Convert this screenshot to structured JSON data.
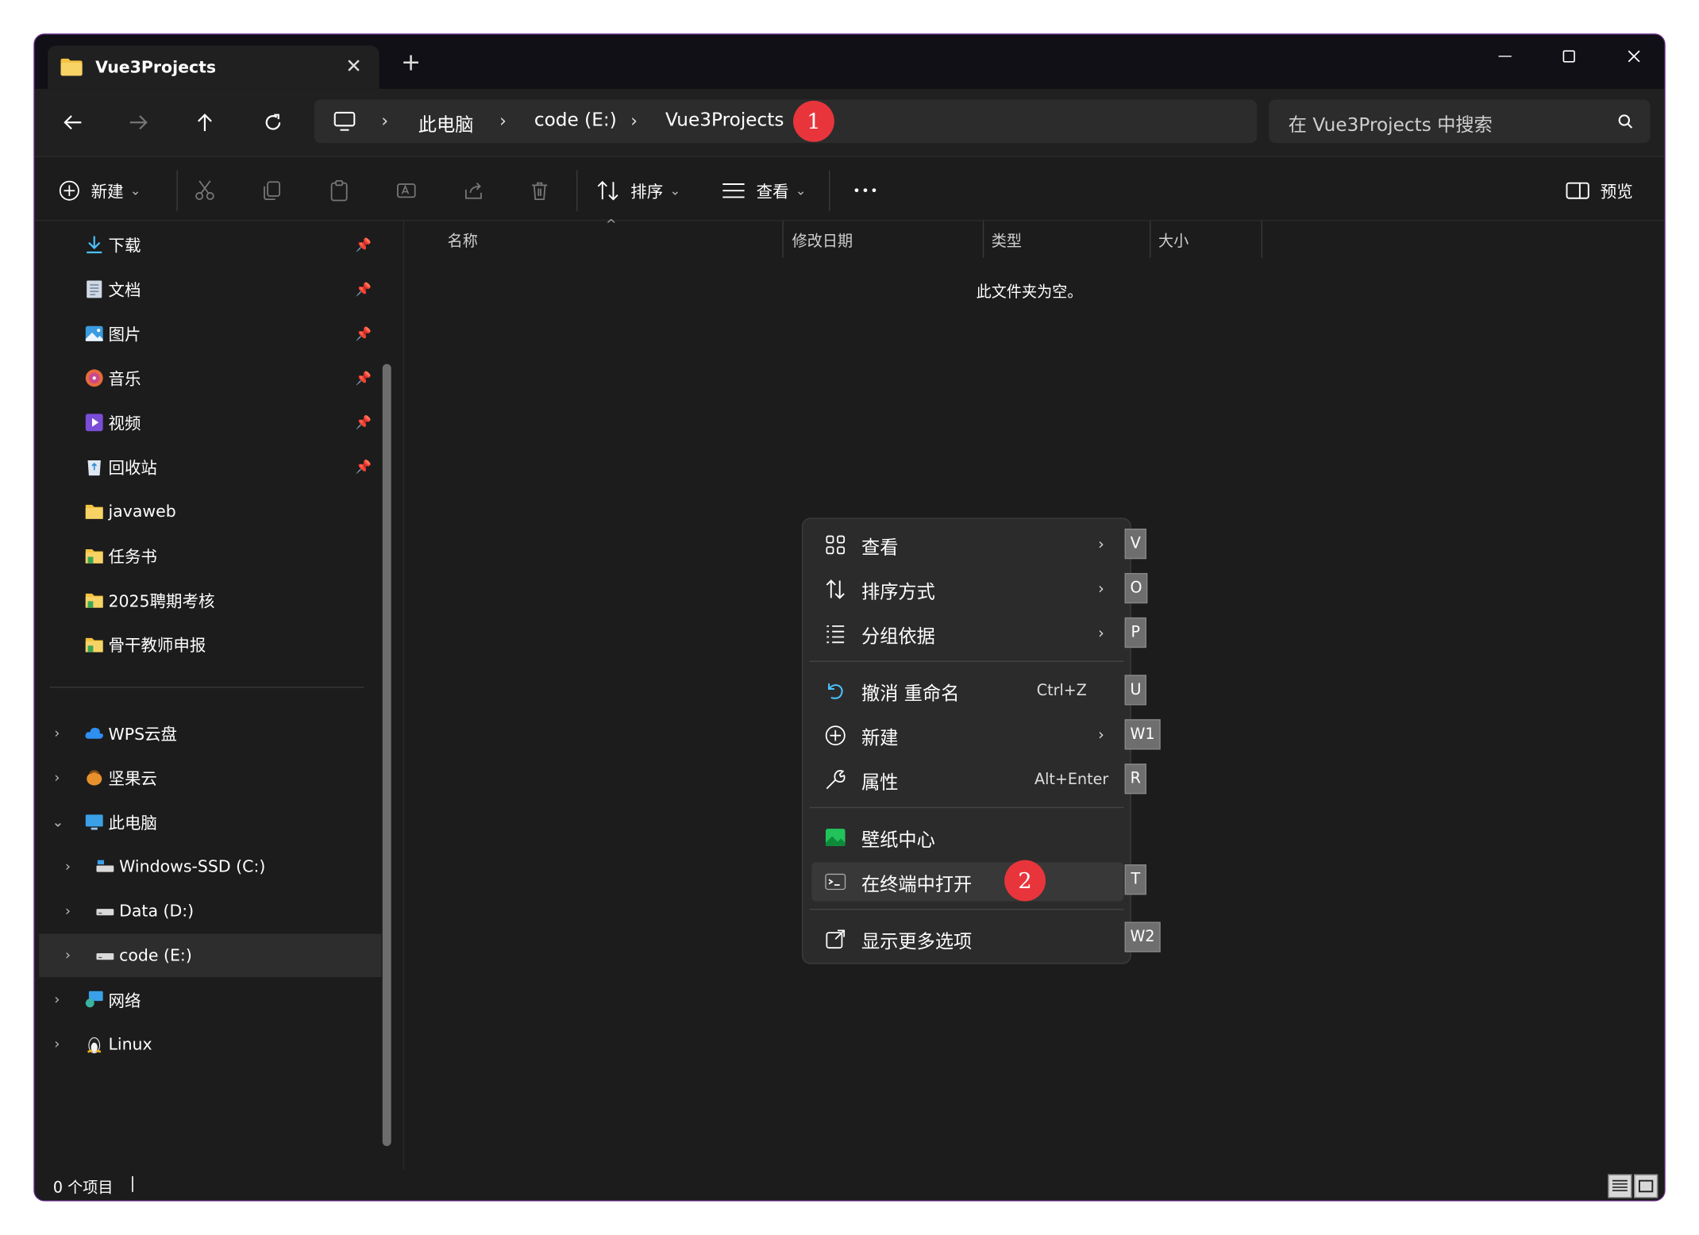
{
  "window": {
    "tab_title": "Vue3Projects",
    "tab_close": "✕",
    "new_tab": "+"
  },
  "address": {
    "crumbs": [
      "此电脑",
      "code (E:)",
      "Vue3Projects"
    ],
    "separator": "›"
  },
  "search": {
    "placeholder": "在 Vue3Projects 中搜索"
  },
  "toolbar": {
    "new_label": "新建",
    "sort_label": "排序",
    "view_label": "查看",
    "more_label": "•••",
    "preview_label": "预览",
    "dropdown": "⌄"
  },
  "sidebar": {
    "quick_access": [
      {
        "label": "下载",
        "icon": "download-icon"
      },
      {
        "label": "文档",
        "icon": "document-icon"
      },
      {
        "label": "图片",
        "icon": "pictures-icon"
      },
      {
        "label": "音乐",
        "icon": "music-icon"
      },
      {
        "label": "视频",
        "icon": "video-icon"
      },
      {
        "label": "回收站",
        "icon": "recycle-bin-icon"
      },
      {
        "label": "javaweb",
        "icon": "folder-icon"
      },
      {
        "label": "任务书",
        "icon": "folder-icon"
      },
      {
        "label": "2025聘期考核",
        "icon": "folder-icon"
      },
      {
        "label": "骨干教师申报",
        "icon": "folder-icon"
      }
    ],
    "pin": "📌",
    "tree": [
      {
        "label": "WPS云盘",
        "icon": "cloud-icon",
        "expanded": false
      },
      {
        "label": "坚果云",
        "icon": "nutstore-icon",
        "expanded": false
      },
      {
        "label": "此电脑",
        "icon": "computer-icon",
        "expanded": true
      },
      {
        "label": "Windows-SSD (C:)",
        "icon": "drive-icon",
        "expanded": false
      },
      {
        "label": "Data (D:)",
        "icon": "drive-icon",
        "expanded": false
      },
      {
        "label": "code (E:)",
        "icon": "drive-icon",
        "expanded": false,
        "selected": true
      },
      {
        "label": "网络",
        "icon": "network-icon",
        "expanded": false
      },
      {
        "label": "Linux",
        "icon": "linux-icon",
        "expanded": false
      }
    ],
    "chev_right": "›",
    "chev_down": "⌄"
  },
  "columns": [
    "名称",
    "修改日期",
    "类型",
    "大小"
  ],
  "sort_caret": "^",
  "empty_message": "此文件夹为空。",
  "status": {
    "items": "0 个项目",
    "bar": "|"
  },
  "context_menu": {
    "items": [
      {
        "label": "查看",
        "key": "V",
        "arrow": "›"
      },
      {
        "label": "排序方式",
        "key": "O",
        "arrow": "›"
      },
      {
        "label": "分组依据",
        "key": "P",
        "arrow": "›"
      },
      {
        "label": "撤消 重命名",
        "key": "U",
        "shortcut": "Ctrl+Z"
      },
      {
        "label": "新建",
        "key": "W1",
        "arrow": "›"
      },
      {
        "label": "属性",
        "key": "R",
        "shortcut": "Alt+Enter"
      },
      {
        "label": "壁纸中心",
        "key": ""
      },
      {
        "label": "在终端中打开",
        "key": "T"
      },
      {
        "label": "显示更多选项",
        "key": "W2"
      }
    ]
  },
  "annotations": [
    "1",
    "2"
  ],
  "colors": {
    "accent": "#4cc2ff",
    "badge": "#e8353c",
    "border": "#6b2d8e",
    "folder": "#f3c340"
  }
}
